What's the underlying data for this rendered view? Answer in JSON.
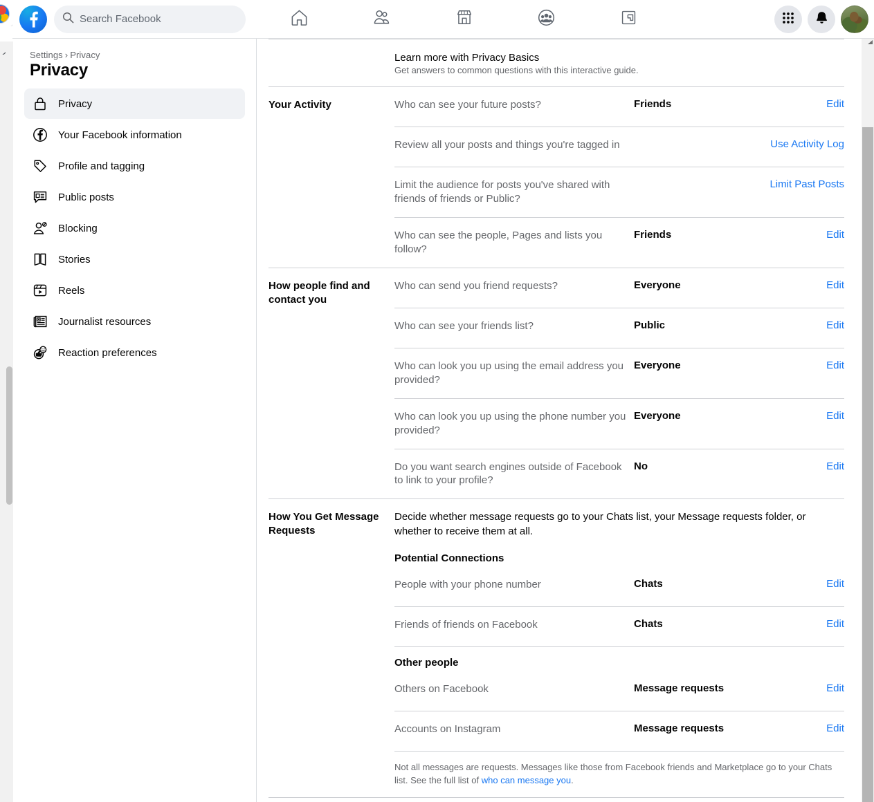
{
  "header": {
    "logo_icon": "facebook-logo",
    "search": {
      "placeholder": "Search Facebook",
      "value": "",
      "icon": "search-icon"
    },
    "nav_tabs": [
      {
        "name": "home",
        "icon": "home-icon"
      },
      {
        "name": "friends",
        "icon": "friends-icon"
      },
      {
        "name": "marketplace",
        "icon": "marketplace-icon"
      },
      {
        "name": "groups",
        "icon": "groups-icon"
      },
      {
        "name": "gaming",
        "icon": "gaming-icon"
      }
    ],
    "menu_icon": "grid-menu-icon",
    "notifications_icon": "bell-icon",
    "avatar_icon": "profile-avatar"
  },
  "sidebar": {
    "breadcrumb_root": "Settings",
    "breadcrumb_separator": "›",
    "breadcrumb_current": "Privacy",
    "title": "Privacy",
    "items": [
      {
        "label": "Privacy",
        "icon": "lock-icon",
        "active": true
      },
      {
        "label": "Your Facebook information",
        "icon": "facebook-circle-icon",
        "active": false
      },
      {
        "label": "Profile and tagging",
        "icon": "tag-icon",
        "active": false
      },
      {
        "label": "Public posts",
        "icon": "comment-lines-icon",
        "active": false
      },
      {
        "label": "Blocking",
        "icon": "person-block-icon",
        "active": false
      },
      {
        "label": "Stories",
        "icon": "book-icon",
        "active": false
      },
      {
        "label": "Reels",
        "icon": "reels-play-icon",
        "active": false
      },
      {
        "label": "Journalist resources",
        "icon": "newspaper-icon",
        "active": false
      },
      {
        "label": "Reaction preferences",
        "icon": "thumbs-up-emoji-icon",
        "active": false
      }
    ]
  },
  "main": {
    "intro": {
      "title": "Learn more with Privacy Basics",
      "subtitle": "Get answers to common questions with this interactive guide."
    },
    "sections": [
      {
        "label": "Your Activity",
        "rows": [
          {
            "question": "Who can see your future posts?",
            "value": "Friends",
            "action": "Edit"
          },
          {
            "question": "Review all your posts and things you're tagged in",
            "value": "",
            "action": "Use Activity Log"
          },
          {
            "question": "Limit the audience for posts you've shared with friends of friends or Public?",
            "value": "",
            "action": "Limit Past Posts"
          },
          {
            "question": "Who can see the people, Pages and lists you follow?",
            "value": "Friends",
            "action": "Edit"
          }
        ]
      },
      {
        "label": "How people find and contact you",
        "rows": [
          {
            "question": "Who can send you friend requests?",
            "value": "Everyone",
            "action": "Edit"
          },
          {
            "question": "Who can see your friends list?",
            "value": "Public",
            "action": "Edit"
          },
          {
            "question": "Who can look you up using the email address you provided?",
            "value": "Everyone",
            "action": "Edit"
          },
          {
            "question": "Who can look you up using the phone number you provided?",
            "value": "Everyone",
            "action": "Edit"
          },
          {
            "question": "Do you want search engines outside of Facebook to link to your profile?",
            "value": "No",
            "action": "Edit"
          }
        ]
      }
    ],
    "message_requests": {
      "label": "How You Get Message Requests",
      "description": "Decide whether message requests go to your Chats list, your Message requests folder, or whether to receive them at all.",
      "group_one_heading": "Potential Connections",
      "group_one_rows": [
        {
          "question": "People with your phone number",
          "value": "Chats",
          "action": "Edit"
        },
        {
          "question": "Friends of friends on Facebook",
          "value": "Chats",
          "action": "Edit"
        }
      ],
      "group_two_heading": "Other people",
      "group_two_rows": [
        {
          "question": "Others on Facebook",
          "value": "Message requests",
          "action": "Edit"
        },
        {
          "question": "Accounts on Instagram",
          "value": "Message requests",
          "action": "Edit"
        }
      ],
      "footnote_text": "Not all messages are requests. Messages like those from Facebook friends and Marketplace go to your Chats list. See the full list of ",
      "footnote_link": "who can message you",
      "footnote_tail": "."
    }
  },
  "colors": {
    "brand_blue": "#1877f2",
    "link_blue": "#1877f2",
    "text_primary": "#050505",
    "text_secondary": "#65676b",
    "divider": "#ced0d4",
    "surface_gray": "#f0f2f5"
  }
}
